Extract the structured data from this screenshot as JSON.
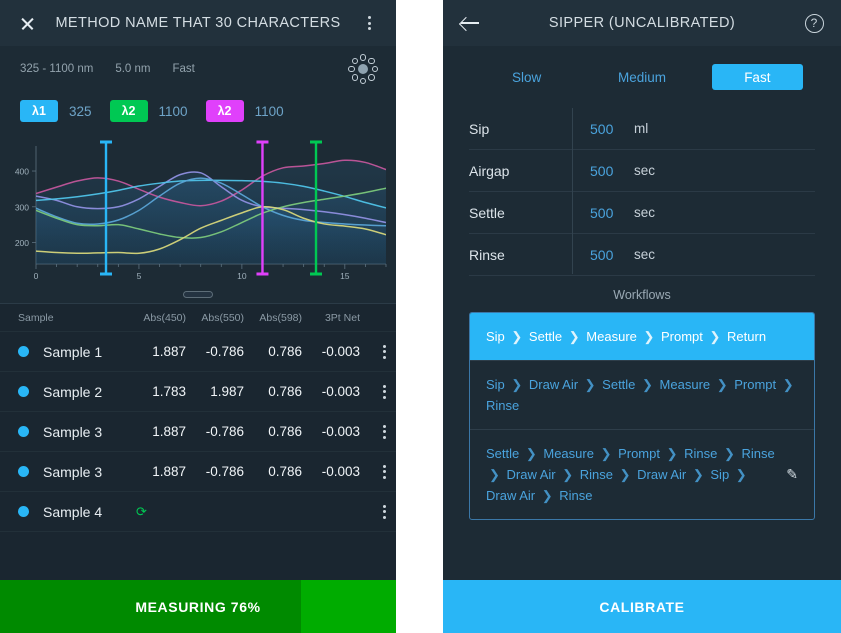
{
  "left": {
    "appbar": {
      "close_icon": "close-icon",
      "title": "METHOD NAME THAT 30 CHARACTERS",
      "menu_icon": "kebab-menu-icon"
    },
    "meta": {
      "range": "325 - 1100 nm",
      "resolution": "5.0 nm",
      "speed": "Fast",
      "carousel_icon": "carousel-icon"
    },
    "lambdas": [
      {
        "chip": "λ1",
        "value": "325",
        "color": "#29b6f6"
      },
      {
        "chip": "λ2",
        "value": "1100",
        "color": "#00c853"
      },
      {
        "chip": "λ2",
        "value": "1100",
        "color": "#e040fb"
      }
    ],
    "table": {
      "headers": {
        "sample": "Sample",
        "c1": "Abs(450)",
        "c2": "Abs(550)",
        "c3": "Abs(598)",
        "c4": "3Pt Net"
      },
      "rows": [
        {
          "name": "Sample 1",
          "c1": "1.887",
          "c2": "-0.786",
          "c3": "0.786",
          "c4": "-0.003",
          "pending": false
        },
        {
          "name": "Sample 2",
          "c1": "1.783",
          "c2": "1.987",
          "c3": "0.786",
          "c4": "-0.003",
          "pending": false
        },
        {
          "name": "Sample 3",
          "c1": "1.887",
          "c2": "-0.786",
          "c3": "0.786",
          "c4": "-0.003",
          "pending": false
        },
        {
          "name": "Sample 3",
          "c1": "1.887",
          "c2": "-0.786",
          "c3": "0.786",
          "c4": "-0.003",
          "pending": false
        },
        {
          "name": "Sample 4",
          "c1": "",
          "c2": "",
          "c3": "",
          "c4": "",
          "pending": true,
          "sync_icon": "sync-icon"
        }
      ]
    },
    "progress": {
      "label": "MEASURING 76%",
      "percent": 76,
      "fill_color": "#008a00",
      "track_color": "#00ac00"
    }
  },
  "right": {
    "appbar": {
      "back_icon": "back-arrow-icon",
      "title": "SIPPER (UNCALIBRATED)",
      "help_icon": "help-icon"
    },
    "speed_segments": [
      {
        "label": "Slow",
        "active": false
      },
      {
        "label": "Medium",
        "active": false
      },
      {
        "label": "Fast",
        "active": true
      }
    ],
    "settings": [
      {
        "label": "Sip",
        "value": "500",
        "unit": "ml"
      },
      {
        "label": "Airgap",
        "value": "500",
        "unit": "sec"
      },
      {
        "label": "Settle",
        "value": "500",
        "unit": "sec"
      },
      {
        "label": "Rinse",
        "value": "500",
        "unit": "sec"
      }
    ],
    "workflows_title": "Workflows",
    "workflows": [
      {
        "steps": [
          "Sip",
          "Settle",
          "Measure",
          "Prompt",
          "Return"
        ],
        "active": true,
        "editable": false
      },
      {
        "steps": [
          "Sip",
          "Draw Air",
          "Settle",
          "Measure",
          "Prompt",
          "Rinse"
        ],
        "active": false,
        "editable": false
      },
      {
        "steps": [
          "Settle",
          "Measure",
          "Prompt",
          "Rinse",
          "Rinse",
          "Draw Air",
          "Rinse",
          "Draw Air",
          "Sip",
          "Draw Air",
          "Rinse"
        ],
        "active": false,
        "editable": true,
        "edit_icon": "pencil-icon"
      }
    ],
    "calibrate_label": "CALIBRATE"
  },
  "chart_data": {
    "type": "line",
    "title": "",
    "xlabel": "",
    "ylabel": "",
    "xlim": [
      0,
      17
    ],
    "ylim": [
      140,
      470
    ],
    "xticks": [
      0,
      5,
      10,
      15
    ],
    "yticks": [
      200,
      300,
      400
    ],
    "grid": false,
    "legend": "none",
    "x": [
      0,
      1,
      2,
      3,
      4,
      5,
      6,
      7,
      8,
      9,
      10,
      11,
      12,
      13,
      14,
      15,
      16,
      17
    ],
    "series": [
      {
        "name": "magenta",
        "color": "#c2569b",
        "values": [
          337,
          355,
          372,
          381,
          372,
          349,
          327,
          312,
          303,
          316,
          347,
          386,
          409,
          414,
          421,
          430,
          424,
          404
        ]
      },
      {
        "name": "violet",
        "color": "#8f8fe0",
        "values": [
          330,
          318,
          300,
          295,
          300,
          322,
          357,
          390,
          395,
          356,
          318,
          300,
          296,
          292,
          286,
          278,
          268,
          256
        ]
      },
      {
        "name": "cyan",
        "color": "#4fc3e8",
        "values": [
          318,
          322,
          328,
          336,
          346,
          358,
          366,
          372,
          374,
          374,
          373,
          371,
          366,
          357,
          344,
          329,
          312,
          297
        ]
      },
      {
        "name": "steel-blue",
        "color": "#5aa4d6",
        "values": [
          296,
          272,
          254,
          252,
          263,
          290,
          330,
          366,
          380,
          366,
          334,
          300,
          276,
          262,
          256,
          252,
          249,
          247
        ]
      },
      {
        "name": "green",
        "color": "#7bc87b",
        "values": [
          290,
          268,
          250,
          247,
          250,
          238,
          224,
          214,
          214,
          230,
          256,
          282,
          300,
          312,
          321,
          330,
          340,
          352
        ]
      },
      {
        "name": "yellow",
        "color": "#d6d67a",
        "values": [
          176,
          172,
          170,
          171,
          172,
          170,
          182,
          208,
          240,
          262,
          283,
          300,
          292,
          268,
          252,
          246,
          238,
          222
        ]
      }
    ],
    "cursors": [
      {
        "x": 3.4,
        "color": "#29b6f6",
        "label": "λ1"
      },
      {
        "x": 11.0,
        "color": "#e040fb",
        "label": "λ2"
      },
      {
        "x": 13.6,
        "color": "#00c853",
        "label": "λ2"
      }
    ]
  }
}
